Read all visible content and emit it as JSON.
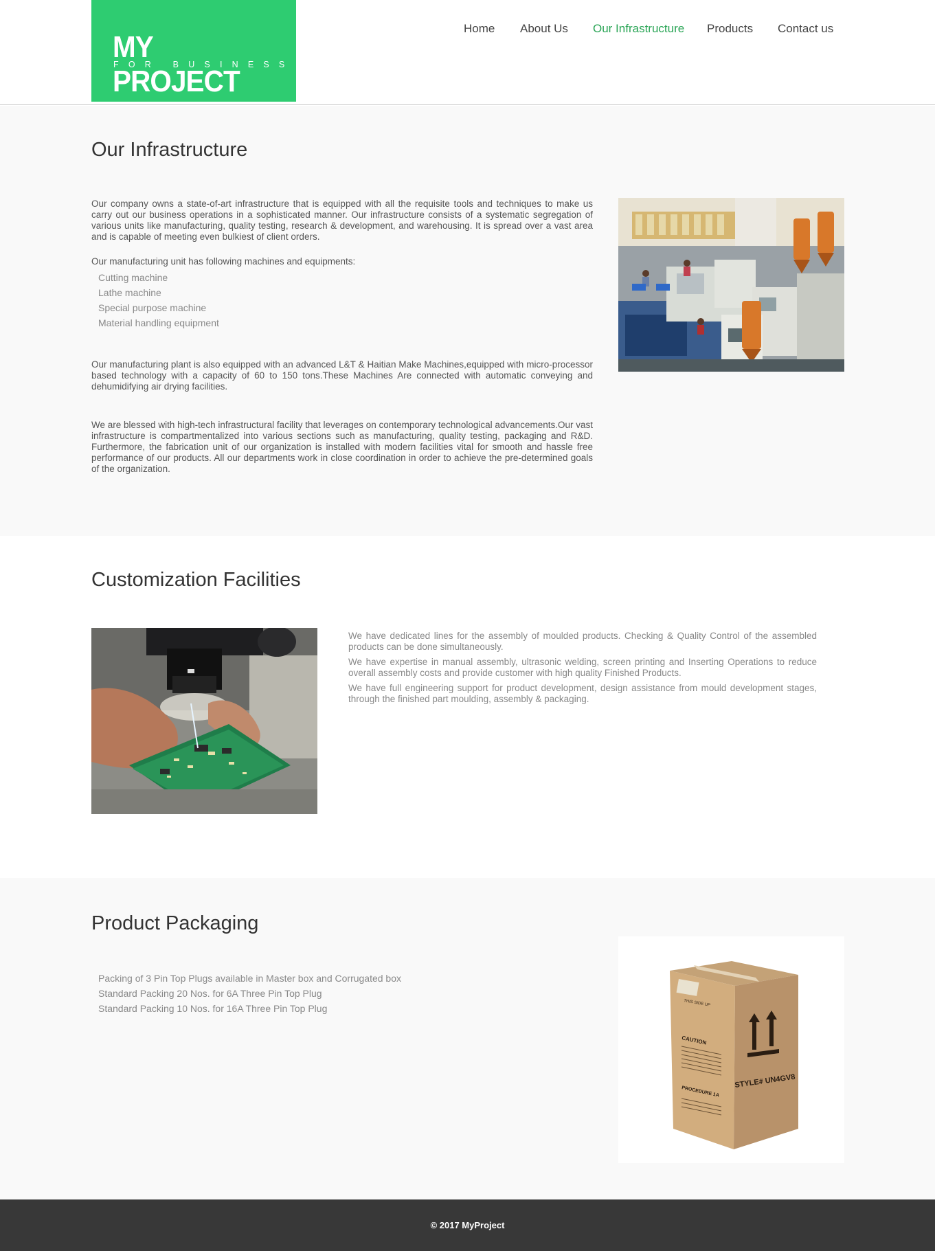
{
  "logo": {
    "title": "MY PROJECT",
    "subtitle": "FOR BUSINESS"
  },
  "nav": [
    {
      "label": "Home"
    },
    {
      "label": "About Us"
    },
    {
      "label": "Our Infrastructure"
    },
    {
      "label": "Products"
    },
    {
      "label": "Contact us"
    }
  ],
  "infrastructure": {
    "title": "Our Infrastructure",
    "intro": "Our company owns a state-of-art infrastructure that is equipped with all the requisite tools and techniques to make us carry out our business operations in a sophisticated manner. Our infrastructure consists of a systematic segregation of various units like manufacturing, quality testing, research & development, and warehousing. It is spread over a vast area and is capable of meeting even bulkiest of client orders.",
    "machines_intro": "Our manufacturing unit has following machines and equipments:",
    "machines": [
      "Cutting machine",
      "Lathe machine",
      "Special purpose machine",
      "Material handling equipment"
    ],
    "plant": "Our manufacturing plant is also equipped with an advanced L&T & Haitian Make Machines,equipped with micro-processor based technology with a capacity of 60 to 150 tons.These Machines Are connected with automatic conveying and dehumidifying air drying facilities.",
    "facility": "We are blessed with high-tech infrastructural facility that leverages on contemporary technological advancements.Our vast infrastructure is compartmentalized into various sections such as manufacturing, quality testing, packaging and R&D. Furthermore, the fabrication unit of our organization is installed with modern facilities vital for smooth and hassle free performance of our products. All our departments work in close coordination in order to achieve the pre-determined goals of the organization."
  },
  "customization": {
    "title": "Customization Facilities",
    "paragraphs": [
      "We have dedicated lines for the assembly of moulded products. Checking & Quality Control of the assembled products can be done simultaneously.",
      "We have expertise in manual assembly, ultrasonic welding, screen printing and Inserting Operations to reduce overall assembly costs and provide customer with high quality Finished Products.",
      "We have full engineering support for product development, design assistance from mould development stages, through the finished part moulding, assembly & packaging."
    ]
  },
  "packaging": {
    "title": "Product Packaging",
    "items": [
      "Packing of 3 Pin Top Plugs available in Master box and Corrugated box",
      "Standard Packing 20 Nos. for 6A Three Pin Top Plug",
      "Standard Packing 10 Nos. for 16A Three Pin Top Plug"
    ],
    "box_label_style": "STYLE# UN4GV8",
    "box_label_caution": "CAUTION",
    "box_label_procedure": "PROCEDURE 1A",
    "box_label_this_side": "THIS SIDE UP"
  },
  "footer": {
    "copyright": "© 2017 MyProject"
  },
  "colors": {
    "brand": "#2ecc71",
    "active_nav": "#2aa556",
    "footer_bg": "#383838"
  }
}
